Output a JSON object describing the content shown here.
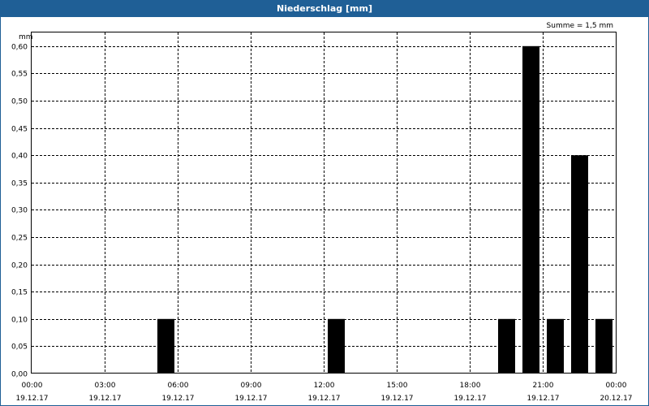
{
  "window": {
    "title": "Niederschlag [mm]"
  },
  "chart_data": {
    "type": "bar",
    "title": "Niederschlag [mm]",
    "annotation": "Summe = 1,5 mm",
    "ylabel": "mm",
    "xlabel": "",
    "grid": true,
    "ylim": [
      0,
      0.625
    ],
    "yticks": [
      {
        "v": 0.0,
        "label": "0,00"
      },
      {
        "v": 0.05,
        "label": "0,05"
      },
      {
        "v": 0.1,
        "label": "0,10"
      },
      {
        "v": 0.15,
        "label": "0,15"
      },
      {
        "v": 0.2,
        "label": "0,20"
      },
      {
        "v": 0.25,
        "label": "0,25"
      },
      {
        "v": 0.3,
        "label": "0,30"
      },
      {
        "v": 0.35,
        "label": "0,35"
      },
      {
        "v": 0.4,
        "label": "0,40"
      },
      {
        "v": 0.45,
        "label": "0,45"
      },
      {
        "v": 0.5,
        "label": "0,50"
      },
      {
        "v": 0.55,
        "label": "0,55"
      },
      {
        "v": 0.6,
        "label": "0,60"
      }
    ],
    "xlim_hours": [
      0,
      24
    ],
    "xticks": [
      {
        "h": 0,
        "time": "00:00",
        "date": "19.12.17"
      },
      {
        "h": 3,
        "time": "03:00",
        "date": "19.12.17"
      },
      {
        "h": 6,
        "time": "06:00",
        "date": "19.12.17"
      },
      {
        "h": 9,
        "time": "09:00",
        "date": "19.12.17"
      },
      {
        "h": 12,
        "time": "12:00",
        "date": "19.12.17"
      },
      {
        "h": 15,
        "time": "15:00",
        "date": "19.12.17"
      },
      {
        "h": 18,
        "time": "18:00",
        "date": "19.12.17"
      },
      {
        "h": 21,
        "time": "21:00",
        "date": "19.12.17"
      },
      {
        "h": 24,
        "time": "00:00",
        "date": "20.12.17"
      }
    ],
    "bars": [
      {
        "time": "19.12.17 06:00",
        "value": 0.1
      },
      {
        "time": "19.12.17 13:00",
        "value": 0.1
      },
      {
        "time": "19.12.17 20:00",
        "value": 0.1
      },
      {
        "time": "19.12.17 21:00",
        "value": 0.6
      },
      {
        "time": "19.12.17 22:00",
        "value": 0.1
      },
      {
        "time": "19.12.17 23:00",
        "value": 0.4
      },
      {
        "time": "20.12.17 00:00",
        "value": 0.1
      }
    ],
    "colors": {
      "bar": "#000000",
      "titlebar": "#1f5f96"
    }
  }
}
